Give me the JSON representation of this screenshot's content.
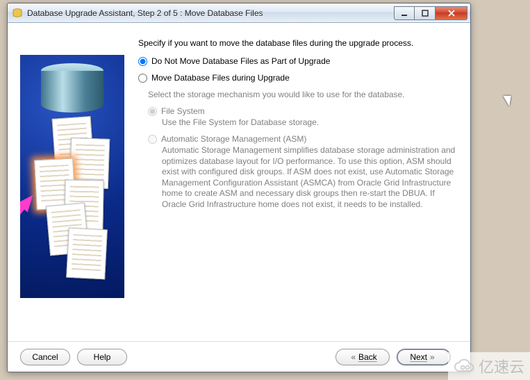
{
  "window": {
    "title": "Database Upgrade Assistant, Step 2 of 5 : Move Database Files"
  },
  "main": {
    "intro": "Specify if you want to move the database files during the upgrade process.",
    "opt_no_move": "Do Not Move Database Files as Part of Upgrade",
    "opt_move": "Move Database Files during Upgrade",
    "select_mech": "Select the storage mechanism you would like to use for the database.",
    "fs_label": "File System",
    "fs_desc": "Use the File System for Database storage.",
    "asm_label": "Automatic Storage Management (ASM)",
    "asm_desc": "Automatic Storage Management simplifies database storage administration and optimizes database layout for I/O performance. To use this option, ASM should exist with configured disk groups. If ASM does not exist, use Automatic Storage Management Configuration Assistant (ASMCA) from Oracle Grid Infrastructure home to create ASM and necessary disk groups then re-start the DBUA. If Oracle Grid Infrastructure home does not exist, it needs to be installed."
  },
  "buttons": {
    "cancel": "Cancel",
    "help": "Help",
    "back": "Back",
    "next": "Next"
  },
  "watermark": "亿速云"
}
